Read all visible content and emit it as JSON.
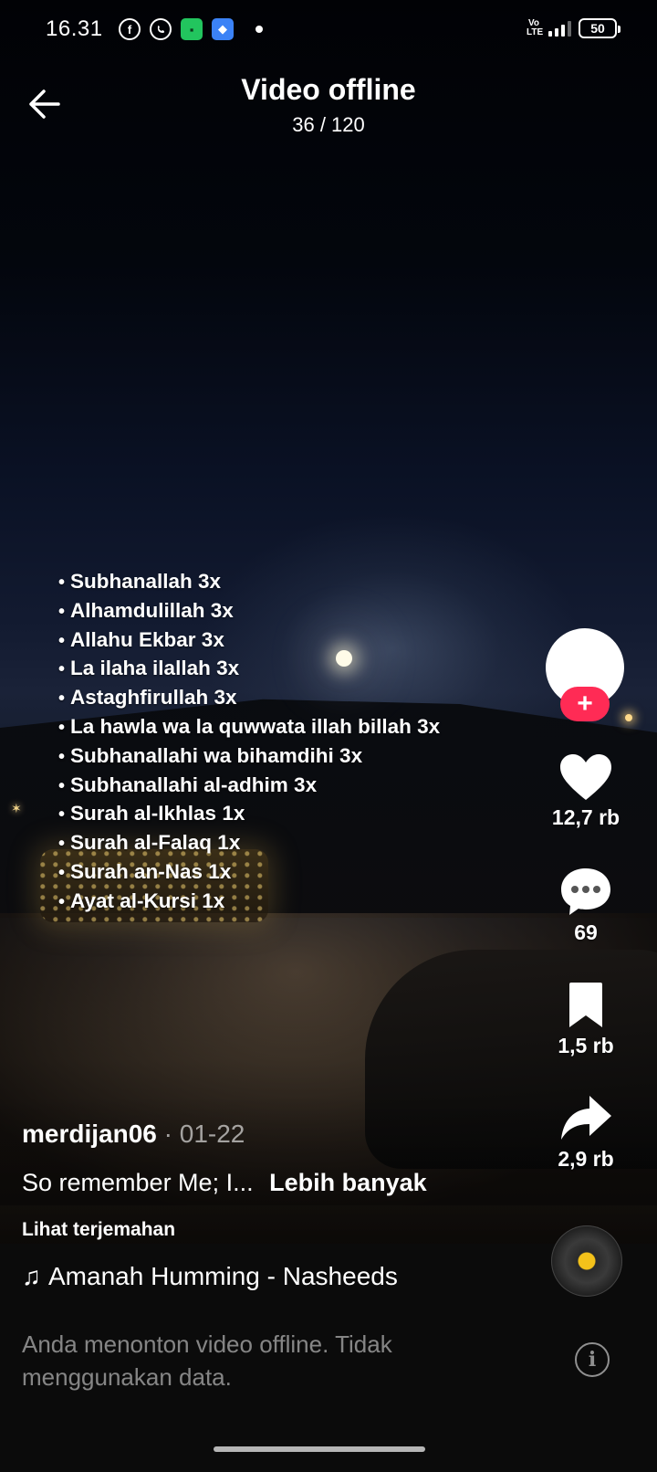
{
  "status_bar": {
    "time": "16.31",
    "notification_icons": [
      "facebook-icon",
      "whatsapp-icon",
      "green-app-icon",
      "blue-app-icon"
    ],
    "network_label": "Vo LTE",
    "battery": "50"
  },
  "header": {
    "title": "Video offline",
    "counter": "36 / 120"
  },
  "video_overlay": {
    "items": [
      "Subhanallah 3x",
      "Alhamdulillah 3x",
      "Allahu Ekbar 3x",
      "La ilaha ilallah 3x",
      "Astaghfirullah 3x",
      "La hawla wa la quwwata illah billah 3x",
      "Subhanallahi wa bihamdihi 3x",
      "Subhanallahi al-adhim 3x",
      "Surah al-Ikhlas 1x",
      "Surah al-Falaq 1x",
      "Surah an-Nas 1x",
      "Ayat al-Kursi 1x"
    ]
  },
  "actions": {
    "follow_symbol": "+",
    "likes": "12,7 rb",
    "comments": "69",
    "saves": "1,5 rb",
    "shares": "2,9 rb"
  },
  "caption": {
    "author": "merdijan06",
    "date": " · 01-22",
    "description": "So remember Me; I...",
    "more": "Lebih banyak",
    "translate": "Lihat terjemahan",
    "music_note": "♫",
    "music": "Amanah Humming - Nasheeds"
  },
  "offline_notice": {
    "text": "Anda menonton video offline. Tidak menggunakan data.",
    "info_symbol": "i"
  },
  "colors": {
    "background": "#000000",
    "follow_button": "#ff2b55",
    "disc_center": "#f4c21a"
  }
}
